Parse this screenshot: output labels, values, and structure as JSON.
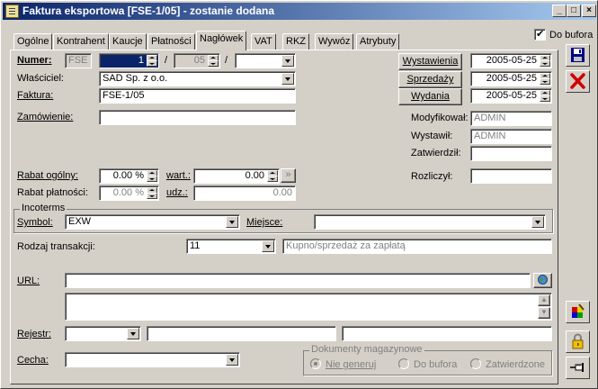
{
  "window": {
    "title": "Faktura eksportowa [FSE-1/05]  - zostanie dodana",
    "min_label": "_",
    "max_label": "□",
    "close_label": "×"
  },
  "do_bufora": {
    "label": "Do bufora",
    "checked": true
  },
  "tabs": [
    {
      "label": "Ogólne"
    },
    {
      "label": "Kontrahent"
    },
    {
      "label": "Kaucje"
    },
    {
      "label": "Płatności"
    },
    {
      "label": "Nagłówek",
      "active": true
    },
    {
      "label": "VAT"
    },
    {
      "label": "RKZ"
    },
    {
      "label": "Wywóz"
    },
    {
      "label": "Atrybuty"
    }
  ],
  "header": {
    "numer_label": "Numer:",
    "numer_prefix": "FSE",
    "numer_value": "1",
    "numer_month": "05",
    "numer_sep1": "/",
    "numer_sep2": "/",
    "numer_series": "",
    "wlasciciel_label": "Właściciel:",
    "wlasciciel_value": "SAD Sp. z o.o.",
    "faktura_label": "Faktura:",
    "faktura_value": "FSE-1/05",
    "zamowienie_label": "Zamówienie:",
    "zamowienie_value": ""
  },
  "dates": {
    "wystawienia_label": "Wystawienia",
    "wystawienia_value": "2005-05-25",
    "sprzedazy_label": "Sprzedaży",
    "sprzedazy_value": "2005-05-25",
    "wydania_label": "Wydania",
    "wydania_value": "2005-05-25"
  },
  "users": {
    "modyfikowal_label": "Modyfikował:",
    "modyfikowal_value": "ADMIN",
    "wystawil_label": "Wystawił:",
    "wystawil_value": "ADMIN",
    "zatwierdzil_label": "Zatwierdził:",
    "zatwierdzil_value": "",
    "rozliczyl_label": "Rozliczył:",
    "rozliczyl_value": ""
  },
  "rabat": {
    "ogolny_label": "Rabat ogólny:",
    "ogolny_value": "0.00 %",
    "wart_label": "wart.:",
    "wart_value": "0.00",
    "platnosci_label": "Rabat płatności:",
    "platnosci_value": "0.00 %",
    "udz_label": "udz.:",
    "udz_value": "0.00"
  },
  "incoterms": {
    "group_label": "Incoterms",
    "symbol_label": "Symbol:",
    "symbol_value": "EXW",
    "miejsce_label": "Miejsce:",
    "miejsce_value": ""
  },
  "transakcja": {
    "label": "Rodzaj transakcji:",
    "code": "11",
    "description": "Kupno/sprzedaż za zapłatą"
  },
  "url": {
    "label": "URL:",
    "value": ""
  },
  "notes": {
    "value": ""
  },
  "rejestr": {
    "label": "Rejestr:",
    "value1": "",
    "value2": "",
    "value3": ""
  },
  "cecha": {
    "label": "Cecha:",
    "value": ""
  },
  "dokumenty": {
    "group_label": "Dokumenty magazynowe",
    "options": [
      {
        "label": "Nie generuj",
        "selected": true
      },
      {
        "label": "Do bufora",
        "selected": false
      },
      {
        "label": "Zatwierdzone",
        "selected": false
      }
    ]
  },
  "icons": {
    "save": "floppy-disk-icon",
    "cancel": "red-x-icon",
    "colors": "palette-icon",
    "lock": "padlock-icon",
    "pin": "pushpin-icon"
  },
  "colors": {
    "titlebar_start": "#0a246a",
    "titlebar_end": "#a6caf0",
    "window_bg": "#d4d0c8",
    "cancel_red": "#d00000",
    "save_blue": "#000080"
  }
}
